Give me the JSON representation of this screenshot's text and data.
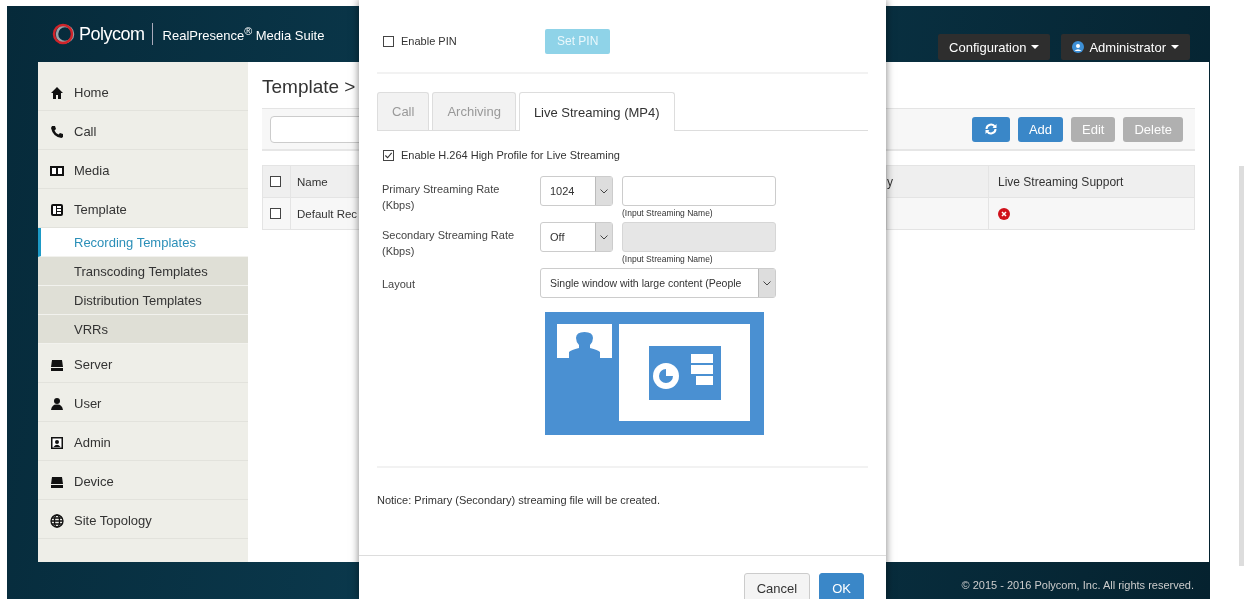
{
  "header": {
    "brand": "Polycom",
    "product": "RealPresence$^{®}$ Media Suite",
    "menus": [
      {
        "label": "Configuration",
        "kind": "menu"
      },
      {
        "label": "Administrator",
        "kind": "user"
      }
    ]
  },
  "sidebar": {
    "items": [
      {
        "label": "Home",
        "selected": false
      },
      {
        "label": "Call",
        "selected": false
      },
      {
        "label": "Media",
        "selected": false
      },
      {
        "label": "Template",
        "selected": false,
        "children": [
          {
            "label": "Recording Templates",
            "selected": true
          },
          {
            "label": "Transcoding Templates",
            "selected": false
          },
          {
            "label": "Distribution Templates",
            "selected": false
          },
          {
            "label": "VRRs",
            "selected": false
          }
        ]
      },
      {
        "label": "Server",
        "selected": false
      },
      {
        "label": "User",
        "selected": false
      },
      {
        "label": "Admin",
        "selected": false
      },
      {
        "label": "Device",
        "selected": false
      },
      {
        "label": "Site Topology",
        "selected": false
      }
    ]
  },
  "page": {
    "breadcrumb": "Template >",
    "toolbar": [
      {
        "kind": "refresh",
        "disabled": false
      },
      {
        "kind": "text",
        "label": "Add",
        "disabled": false
      },
      {
        "kind": "text",
        "label": "Edit",
        "disabled": true
      },
      {
        "kind": "text",
        "label": "Delete",
        "disabled": true
      }
    ],
    "table": {
      "header_checked": false,
      "columns": [
        "Name",
        "y",
        "Live Streaming Support"
      ],
      "rows": [
        {
          "checked": false,
          "name": "Default Rec",
          "live_streaming": false
        }
      ]
    }
  },
  "dialog": {
    "enable_pin": {
      "label": "Enable PIN",
      "checked": false
    },
    "set_pin": {
      "label": "Set PIN",
      "disabled": true
    },
    "tabs": [
      {
        "label": "Call",
        "selected": false
      },
      {
        "label": "Archiving",
        "selected": false
      },
      {
        "label": "Live Streaming (MP4)",
        "selected": true
      }
    ],
    "high_profile": {
      "label": "Enable H.264 High Profile for Live Streaming",
      "checked": true
    },
    "rates": [
      {
        "label": "Primary Streaming Rate (Kbps)",
        "value": "1024",
        "hint": "(Input Streaming Name)",
        "disabled": false
      },
      {
        "label": "Secondary Streaming Rate (Kbps)",
        "value": "Off",
        "hint": "(Input Streaming Name)",
        "disabled": true
      }
    ],
    "layout": {
      "label": "Layout",
      "value": "Single window with large content (People"
    },
    "notice": "Notice: Primary (Secondary) streaming file will be created.",
    "buttons": [
      {
        "label": "Cancel",
        "primary": false
      },
      {
        "label": "OK",
        "primary": true
      }
    ]
  },
  "footer": "© 2015 - 2016 Polycom, Inc. All rights reserved."
}
